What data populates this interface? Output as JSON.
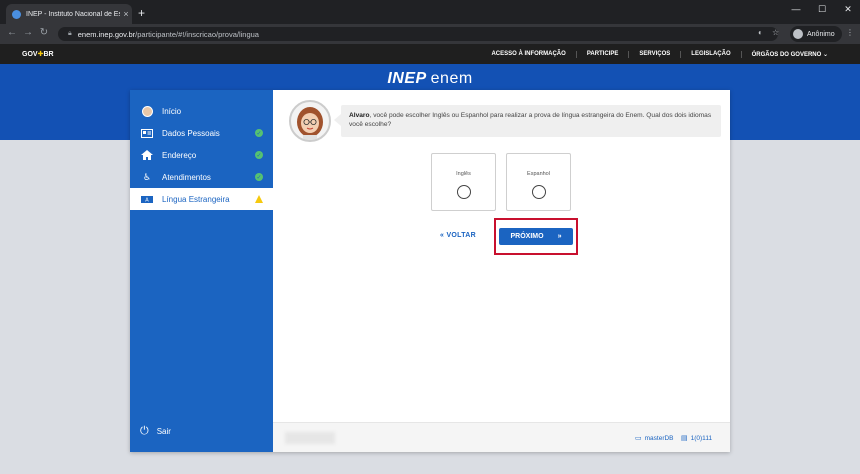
{
  "browser": {
    "tab_title": "INEP - Instituto Nacional de Est...",
    "tab_close": "×",
    "new_tab": "+",
    "url_host": "enem.inep.gov.br",
    "url_path": "/participante/#!/inscricao/prova/lingua",
    "profile_label": "Anônimo",
    "window_controls": [
      "—",
      "☐",
      "✕"
    ]
  },
  "gov_bar": {
    "logo_left": "GOV",
    "logo_right": "BR",
    "links": [
      "ACESSO À INFORMAÇÃO",
      "PARTICIPE",
      "SERVIÇOS",
      "LEGISLAÇÃO",
      "ÓRGÃOS DO GOVERNO ⌄"
    ]
  },
  "brand": {
    "inep": "INEP",
    "enem": "enem"
  },
  "sidebar": {
    "items": [
      {
        "label": "Início",
        "icon": "user-avatar-icon",
        "status": ""
      },
      {
        "label": "Dados Pessoais",
        "icon": "id-card-icon",
        "status": "ok"
      },
      {
        "label": "Endereço",
        "icon": "home-icon",
        "status": "ok"
      },
      {
        "label": "Atendimentos",
        "icon": "accessibility-icon",
        "status": "ok"
      },
      {
        "label": "Língua Estrangeira",
        "icon": "language-icon",
        "status": "warning"
      }
    ],
    "logout": "Sair"
  },
  "dialog": {
    "name": "Alvaro",
    "message": ", você pode escolher Inglês ou Espanhol para realizar a prova de língua estrangeira do Enem. Qual dos dois idiomas você escolhe?"
  },
  "options": [
    {
      "label": "Inglês"
    },
    {
      "label": "Espanhol"
    }
  ],
  "actions": {
    "back": "« VOLTAR",
    "next": "PRÓXIMO",
    "next_arrow": "»"
  },
  "footer": {
    "device": "masterDB",
    "version": "1(0)111"
  },
  "colors": {
    "primary": "#1b64c1",
    "gov_blue": "#1351b4",
    "highlight": "#c8102e",
    "ok": "#56c271",
    "warning": "#f6c90e"
  }
}
